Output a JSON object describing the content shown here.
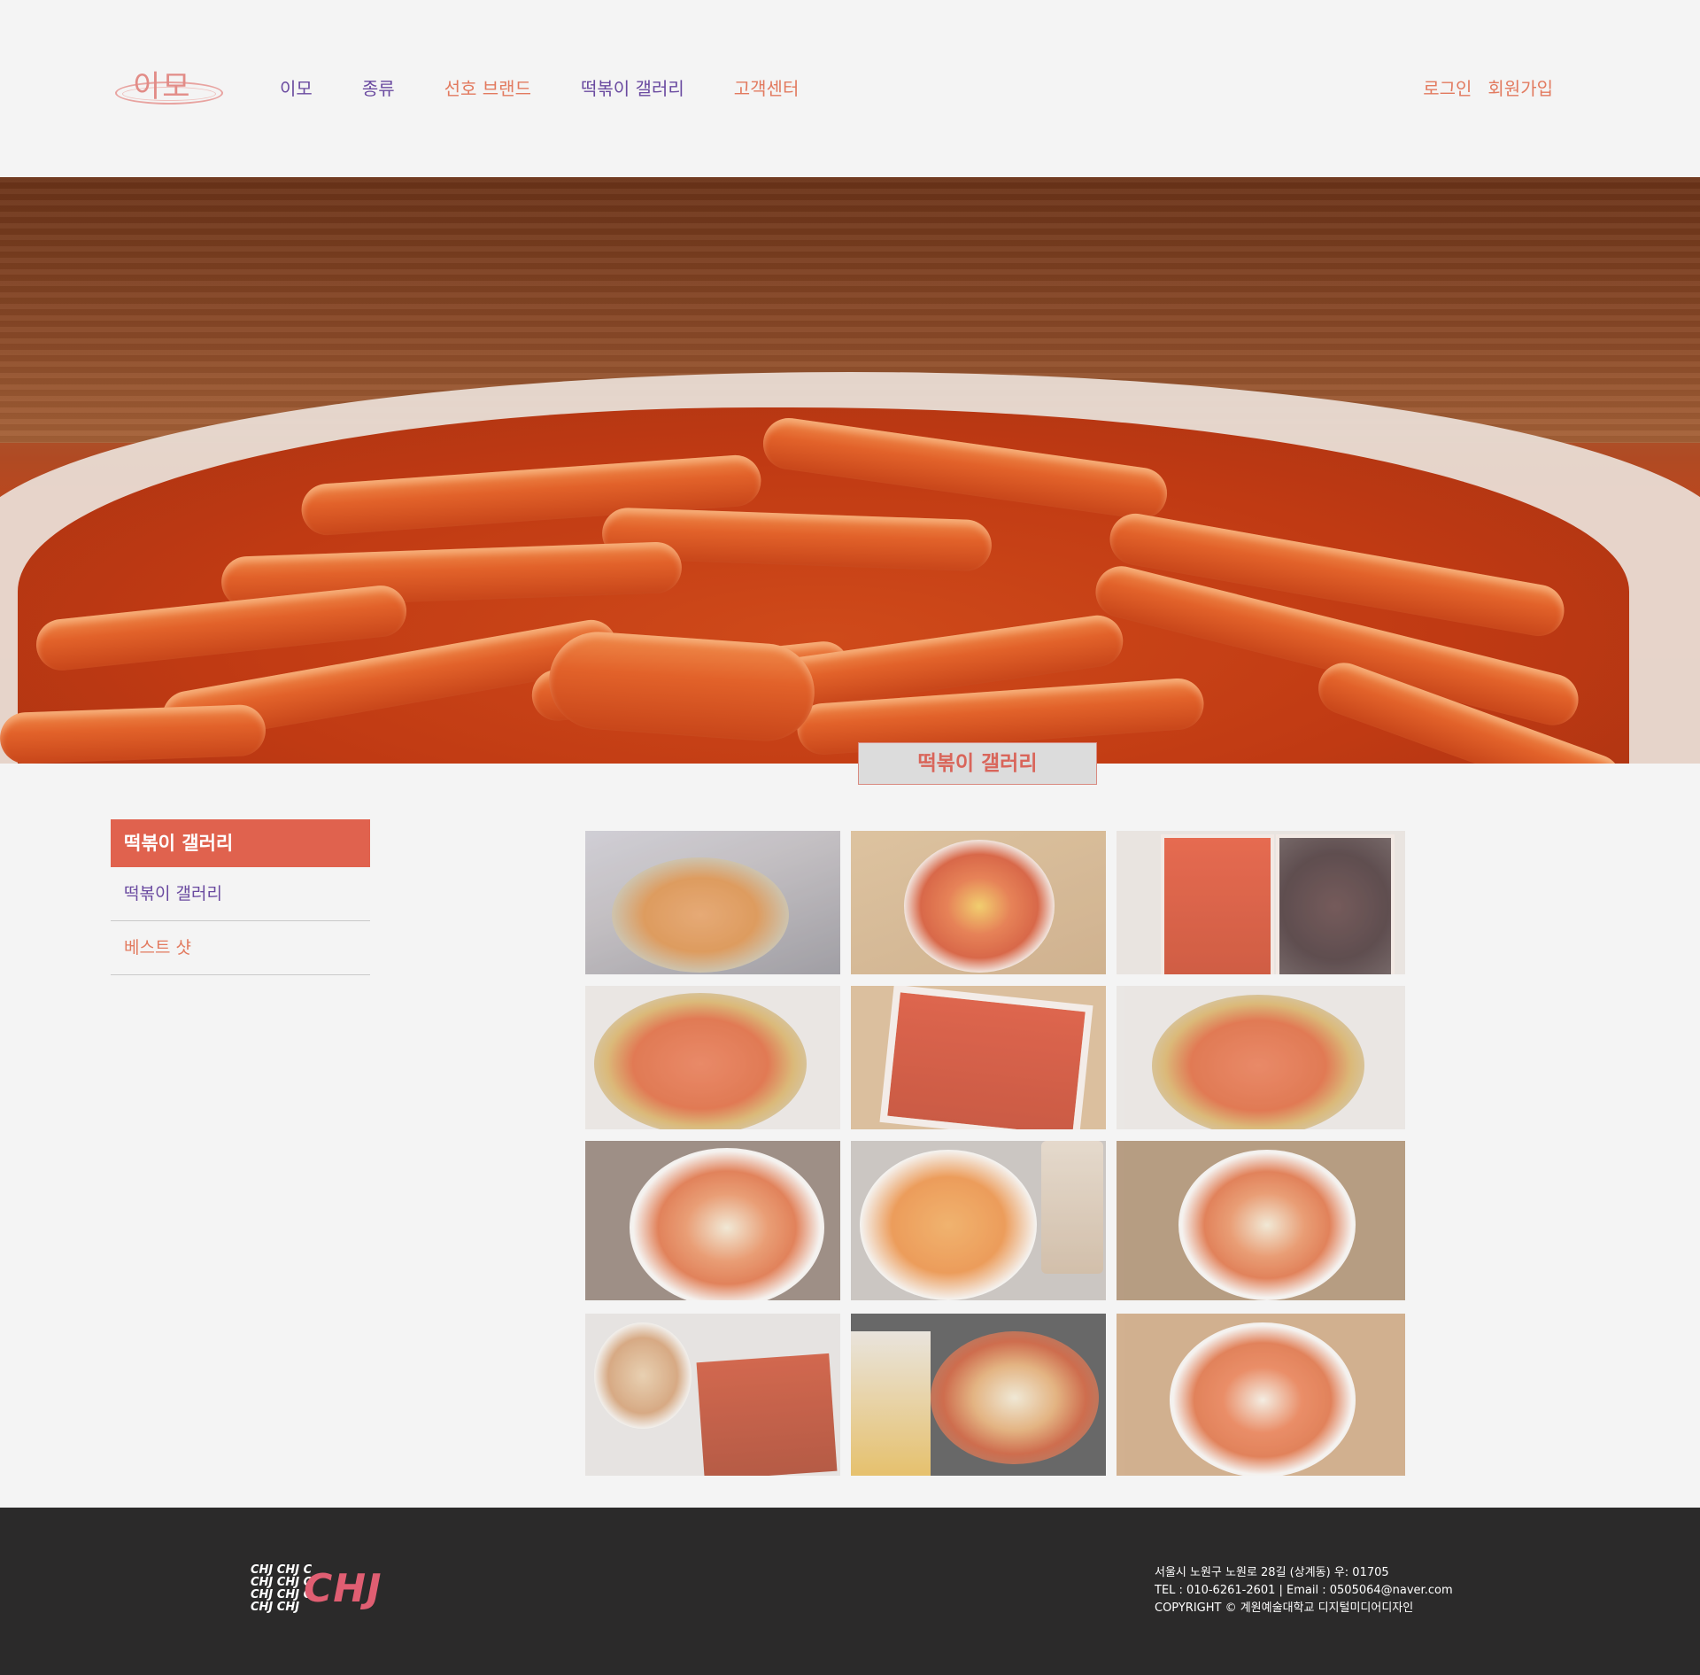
{
  "brand": {
    "logo_text": "이모"
  },
  "nav": {
    "items": [
      {
        "label": "이모"
      },
      {
        "label": "종류"
      },
      {
        "label": "선호 브랜드"
      },
      {
        "label": "떡볶이 갤러리"
      },
      {
        "label": "고객센터"
      }
    ],
    "login": "로그인",
    "signup": "회원가입"
  },
  "hero": {
    "title": "떡볶이 갤러리"
  },
  "sidebar": {
    "heading": "떡볶이 갤러리",
    "items": [
      {
        "label": "떡볶이 갤러리"
      },
      {
        "label": "베스트 샷"
      }
    ]
  },
  "gallery": {
    "count": 12
  },
  "footer": {
    "logo_text": "CHJ",
    "address": "서울시 노원구 노원로 28길 (상계동) 우: 01705",
    "contact": "TEL : 010-6261-2601  |  Email : 0505064@naver.com",
    "copyright": "COPYRIGHT © 계원예술대학교 디지털미디어디자인"
  },
  "colors": {
    "accent": "#e0624e",
    "nav_purple": "#6a4aa0",
    "nav_salmon": "#e27a5f",
    "footer_bg": "#2b2a2a",
    "logo_pink": "#e05e72"
  }
}
